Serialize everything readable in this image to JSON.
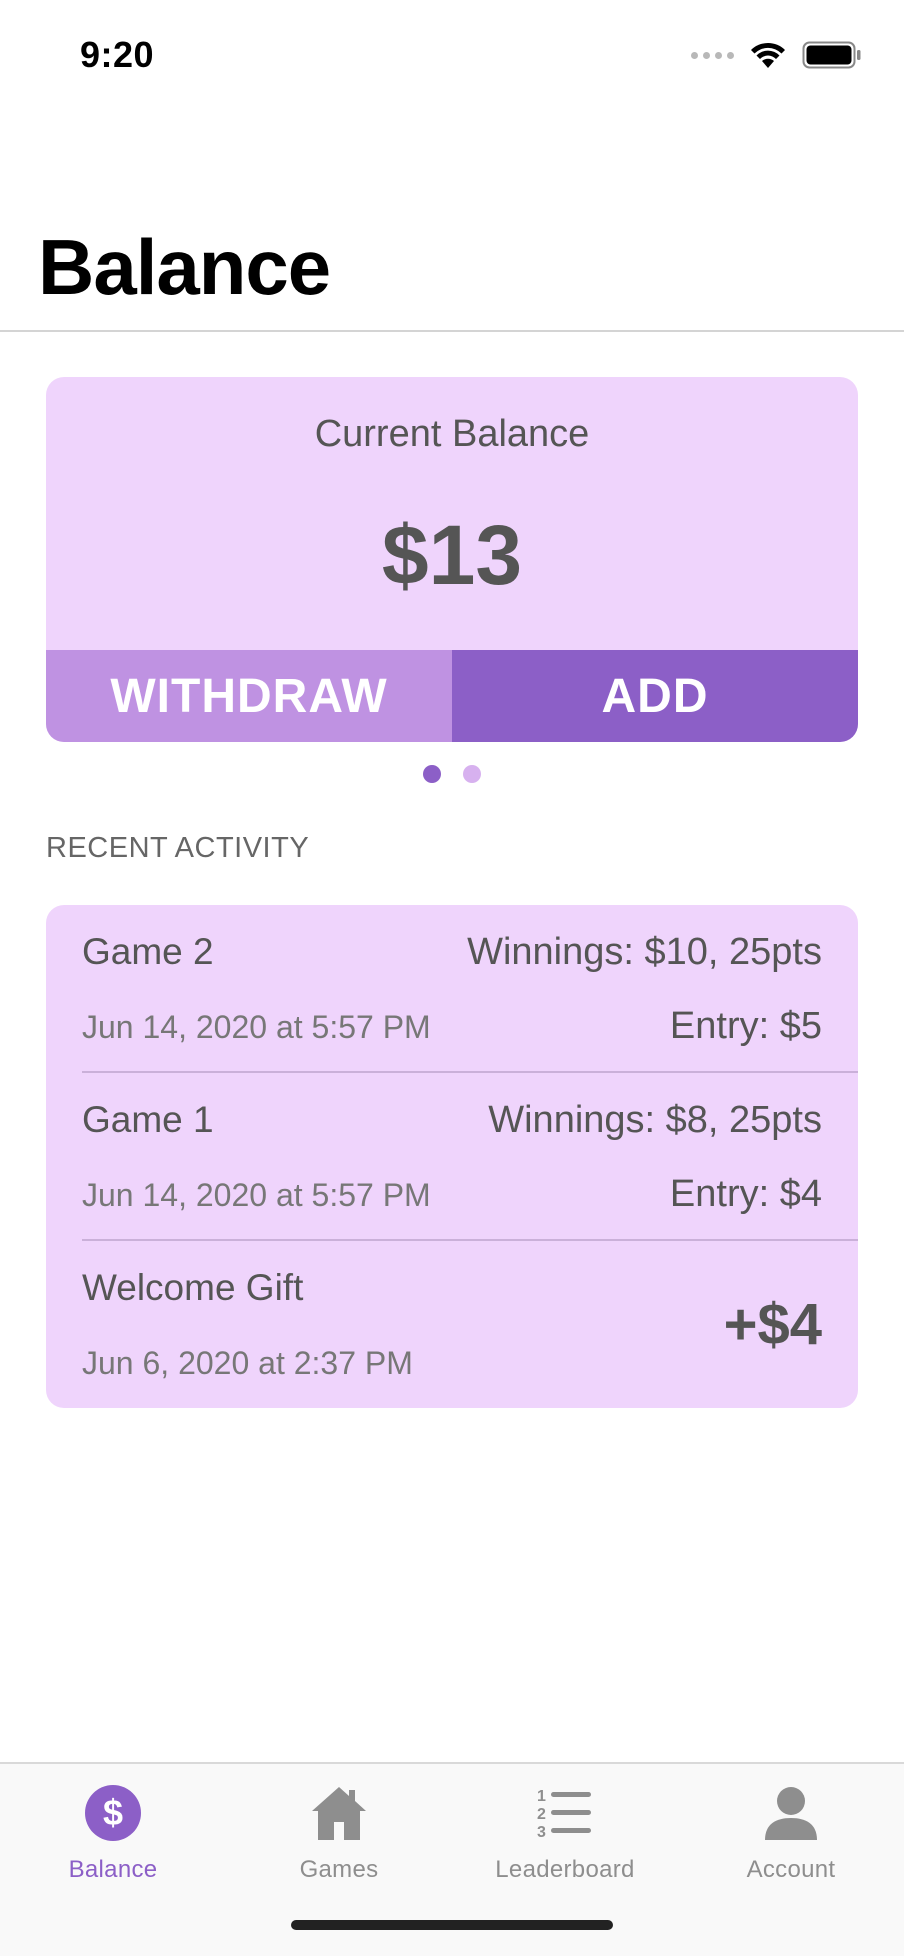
{
  "status_bar": {
    "time": "9:20"
  },
  "page": {
    "title": "Balance"
  },
  "balance_card": {
    "label": "Current Balance",
    "amount": "$13",
    "withdraw_label": "WITHDRAW",
    "add_label": "ADD"
  },
  "pager": {
    "current_page": 1,
    "total_pages": 2
  },
  "recent_activity": {
    "header": "RECENT ACTIVITY",
    "items": [
      {
        "title": "Game 2",
        "date": "Jun 14, 2020 at 5:57 PM",
        "winnings": "Winnings: $10, 25pts",
        "entry": "Entry: $5"
      },
      {
        "title": "Game 1",
        "date": "Jun 14, 2020 at 5:57 PM",
        "winnings": "Winnings: $8, 25pts",
        "entry": "Entry: $4"
      },
      {
        "title": "Welcome Gift",
        "date": "Jun 6, 2020 at 2:37 PM",
        "amount": "+$4"
      }
    ]
  },
  "tab_bar": {
    "tabs": [
      {
        "label": "Balance",
        "icon": "dollar-circle-icon",
        "active": true
      },
      {
        "label": "Games",
        "icon": "house-icon",
        "active": false
      },
      {
        "label": "Leaderboard",
        "icon": "numbered-list-icon",
        "active": false
      },
      {
        "label": "Account",
        "icon": "person-icon",
        "active": false
      }
    ]
  },
  "colors": {
    "accent": "#8c5fc7",
    "accent_light": "#bf92e2",
    "card_background": "#efd4fc",
    "inactive_tab": "#8e8e8e"
  }
}
